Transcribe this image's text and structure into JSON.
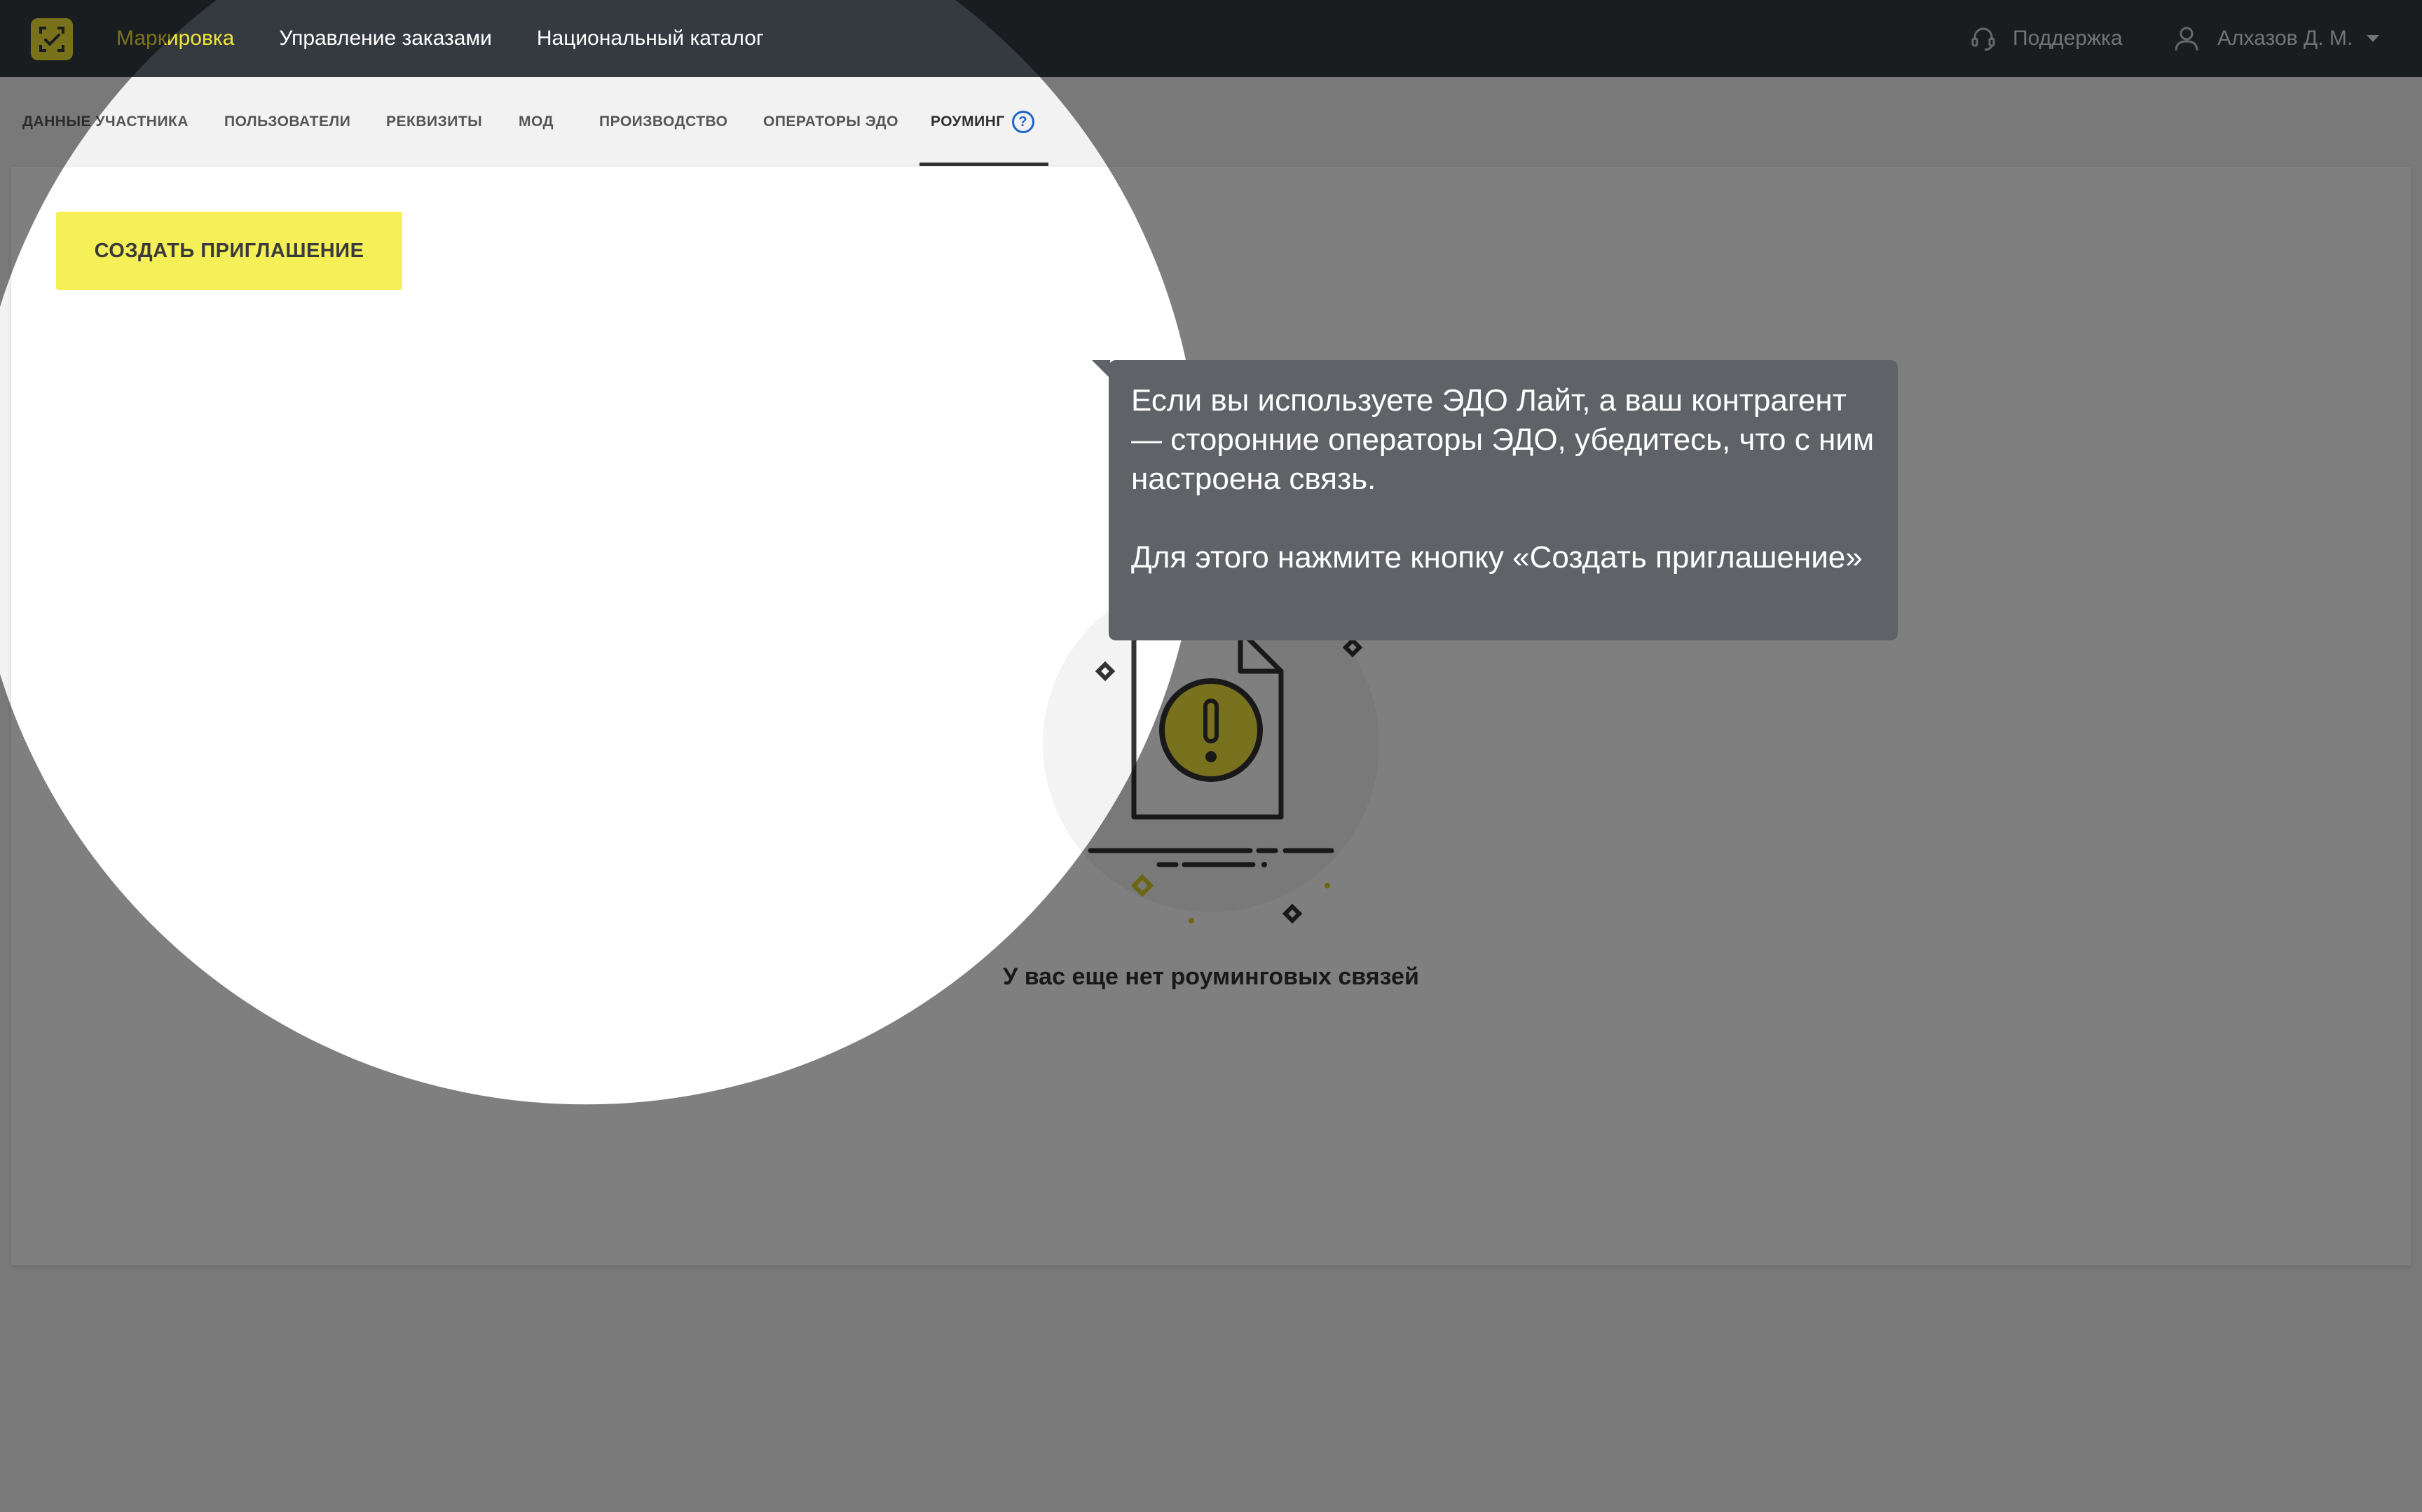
{
  "topbar": {
    "nav": [
      {
        "label": "Маркировка",
        "active": true
      },
      {
        "label": "Управление заказами",
        "active": false
      },
      {
        "label": "Национальный каталог",
        "active": false
      }
    ],
    "support_label": "Поддержка",
    "user_name": "Алхазов Д. М."
  },
  "tabs": [
    {
      "label": "ДАННЫЕ УЧАСТНИКА"
    },
    {
      "label": "ПОЛЬЗОВАТЕЛИ"
    },
    {
      "label": "РЕКВИЗИТЫ"
    },
    {
      "label": "МОД"
    },
    {
      "label": "ПРОИЗВОДСТВО"
    },
    {
      "label": "ОПЕРАТОРЫ ЭДО"
    },
    {
      "label": "РОУМИНГ",
      "active": true,
      "help_icon": "question-circle-icon"
    }
  ],
  "content": {
    "create_button": "СОЗДАТЬ ПРИГЛАШЕНИЕ",
    "empty_text": "У вас еще нет роуминговых связей"
  },
  "tooltip": {
    "paragraph1": "Если вы используете ЭДО Лайт, а ваш контрагент — сторонние операторы ЭДО, убедитесь, что с ним настроена связь.",
    "paragraph2": "Для этого нажмите кнопку «Создать приглашение»"
  },
  "colors": {
    "accent": "#f2e437",
    "topbar": "#343a40",
    "button": "#f5f057",
    "link_blue": "#1f65c4",
    "tooltip_bg": "#5f6368",
    "overlay": "rgba(0,0,0,0.5)"
  }
}
